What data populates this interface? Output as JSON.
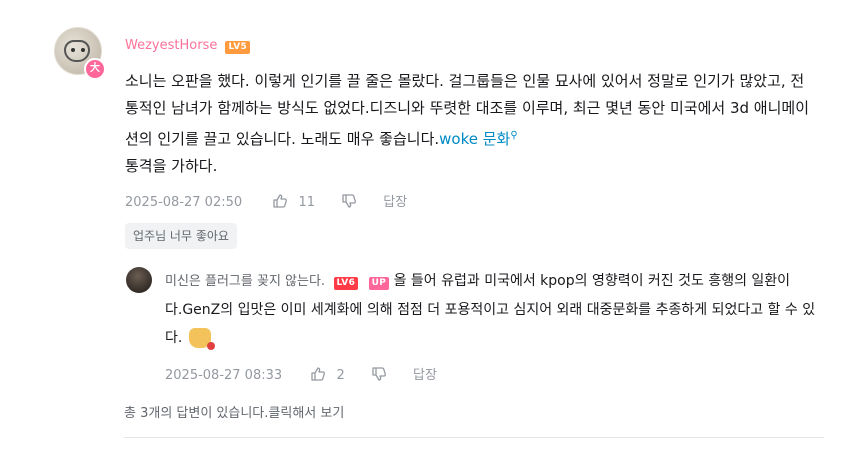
{
  "comment": {
    "username": "WezyestHorse",
    "level": "LV5",
    "avatar_badge": "大",
    "text": "소니는 오판을 했다. 이렇게 인기를 끌 줄은 몰랐다. 걸그룹들은 인물 묘사에 있어서 정말로 인기가 많았고, 전통적인 남녀가 함께하는 방식도 없었다.디즈니와 뚜렷한 대조를 이루며, 최근 몇년 동안 미국에서 3d 애니메이션의 인기를 끌고 있습니다. 노래도 매우 좋습니다.",
    "keyword": "woke 문화",
    "text_after": "통격을 가하다.",
    "date": "2025-08-27 02:50",
    "likes": "11",
    "reply_label": "답장",
    "tag": "업주님 너무 좋아요"
  },
  "reply": {
    "username": "미신은 플러그를 꽂지 않는다.",
    "level": "LV6",
    "up_badge": "UP",
    "text": "올 들어 유럽과 미국에서 kpop의 영향력이 커진 것도 흥행의 일환이다.GenZ의 입맛은 이미 세계화에 의해 점점 더 포용적이고 심지어 외래 대중문화를 추종하게 되었다고 할 수 있다.",
    "date": "2025-08-27 08:33",
    "likes": "2",
    "reply_label": "답장"
  },
  "more_replies": "총 3개의 답변이 있습니다.클릭해서 보기",
  "colors": {
    "username": "#fb7299",
    "level5": "#ff9b3e",
    "level6": "#ff3b46",
    "keyword": "#008ac5",
    "meta": "#9499a0"
  }
}
